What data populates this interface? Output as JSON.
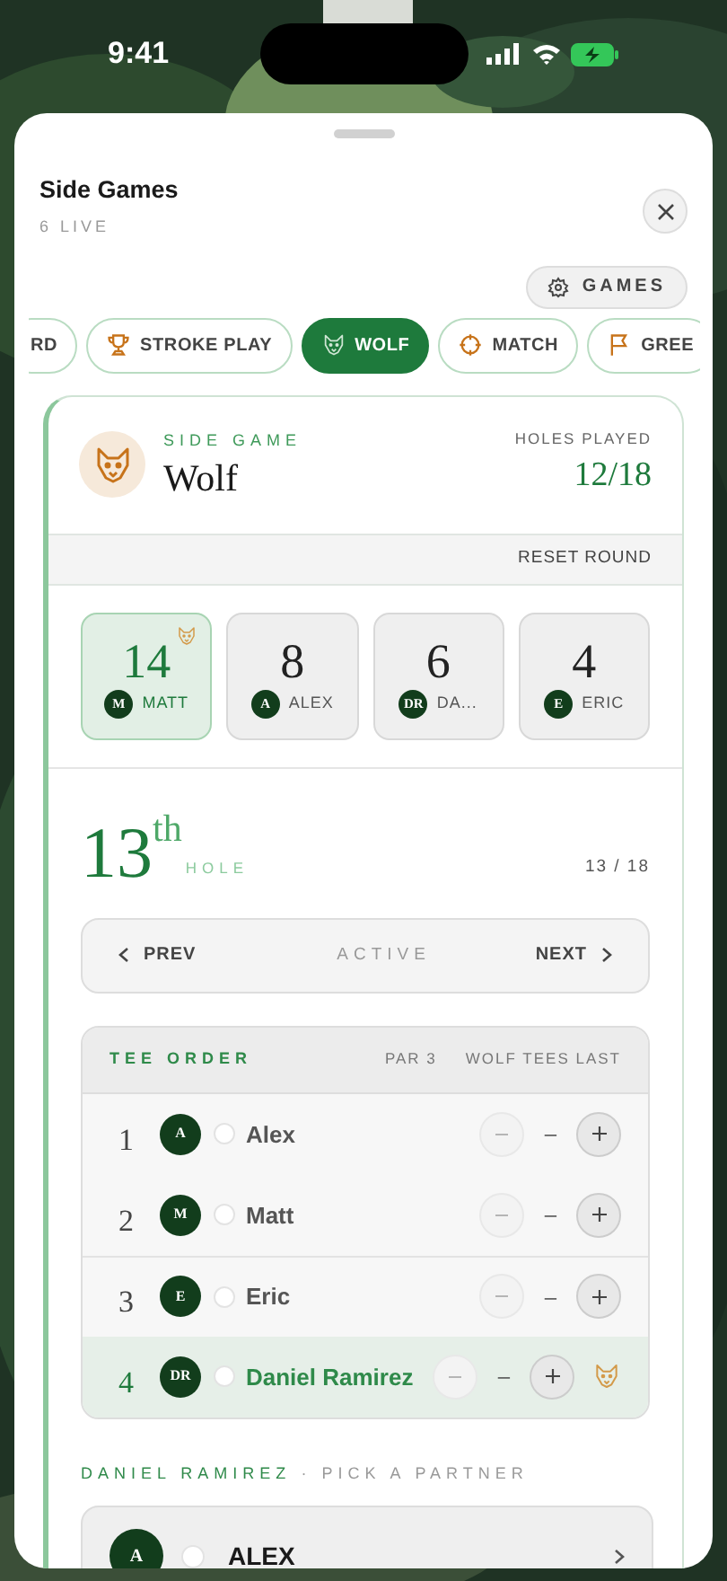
{
  "status_bar": {
    "time": "9:41"
  },
  "sheet": {
    "title": "Side Games",
    "subtitle": "6 LIVE",
    "games_button": "GAMES"
  },
  "tabs": [
    {
      "label": "RD",
      "kind": "plain",
      "selected": false
    },
    {
      "label": "STROKE PLAY",
      "kind": "trophy",
      "selected": false
    },
    {
      "label": "WOLF",
      "kind": "wolf",
      "selected": true
    },
    {
      "label": "MATCH",
      "kind": "target",
      "selected": false
    },
    {
      "label": "GREE",
      "kind": "flag",
      "selected": false
    }
  ],
  "game": {
    "eyebrow": "SIDE GAME",
    "name": "Wolf",
    "holes_label": "HOLES PLAYED",
    "holes_value": "12/18",
    "reset": "RESET ROUND"
  },
  "scores": [
    {
      "points": "14",
      "initials": "M",
      "name": "MATT",
      "selected": true,
      "is_wolf": true
    },
    {
      "points": "8",
      "initials": "A",
      "name": "ALEX",
      "selected": false,
      "is_wolf": false
    },
    {
      "points": "6",
      "initials": "DR",
      "name": "DA...",
      "selected": false,
      "is_wolf": false
    },
    {
      "points": "4",
      "initials": "E",
      "name": "ERIC",
      "selected": false,
      "is_wolf": false
    }
  ],
  "hole": {
    "number": "13",
    "suffix": "th",
    "label": "HOLE",
    "progress": "13 / 18"
  },
  "nav": {
    "prev": "PREV",
    "status": "ACTIVE",
    "next": "NEXT"
  },
  "tee_order": {
    "title": "TEE ORDER",
    "par": "PAR 3",
    "note": "WOLF TEES LAST",
    "rows": [
      {
        "order": "1",
        "initials": "A",
        "name": "Alex",
        "score": "–",
        "is_wolf": false,
        "selected": false
      },
      {
        "order": "2",
        "initials": "M",
        "name": "Matt",
        "score": "–",
        "is_wolf": false,
        "selected": false
      },
      {
        "order": "3",
        "initials": "E",
        "name": "Eric",
        "score": "–",
        "is_wolf": false,
        "selected": false
      },
      {
        "order": "4",
        "initials": "DR",
        "name": "Daniel Ramirez",
        "score": "–",
        "is_wolf": true,
        "selected": false
      }
    ]
  },
  "partner": {
    "heading_name": "DANIEL RAMIREZ",
    "heading_rest": "· PICK A PARTNER",
    "options": [
      {
        "initials": "A",
        "name": "ALEX",
        "selected": false
      }
    ]
  }
}
